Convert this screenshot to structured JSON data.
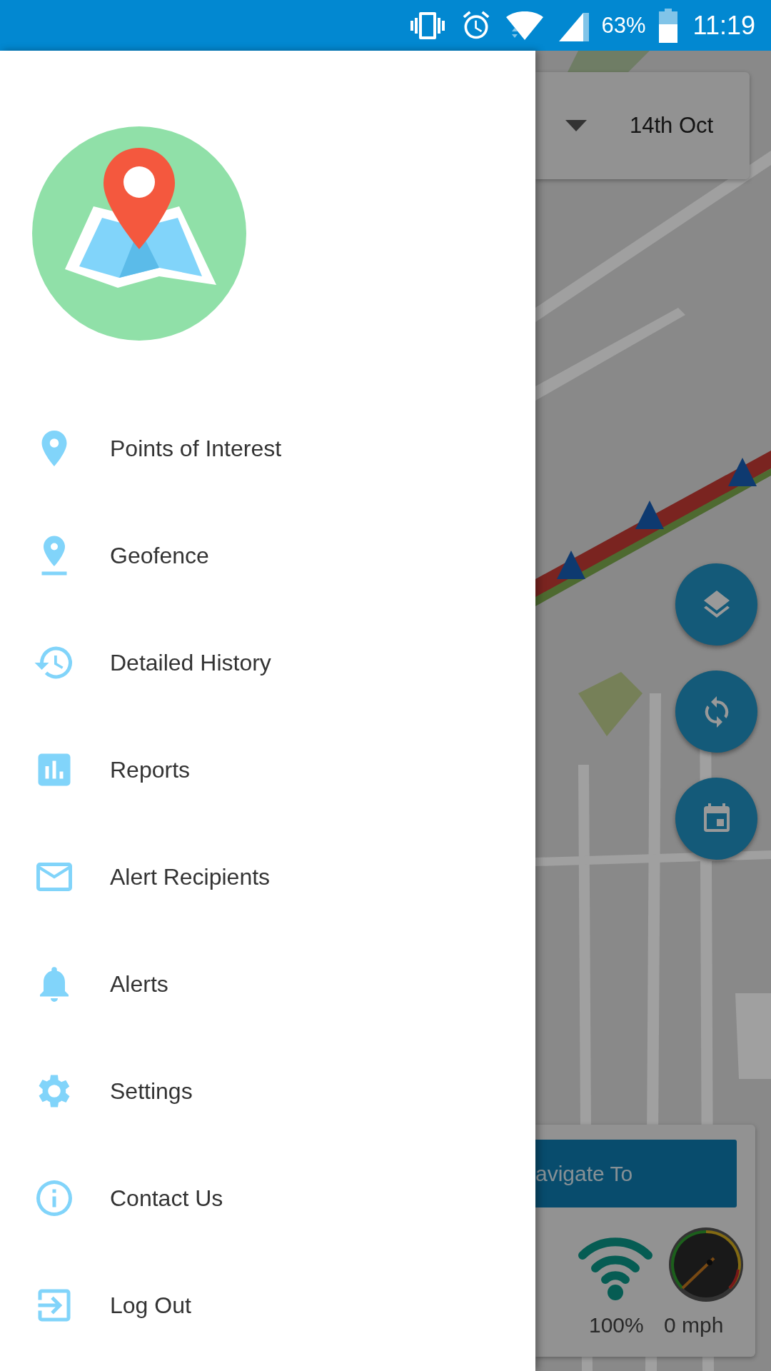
{
  "status_bar": {
    "battery_text": "63%",
    "time": "11:19"
  },
  "drawer": {
    "items": [
      {
        "label": "Points of Interest"
      },
      {
        "label": "Geofence"
      },
      {
        "label": "Detailed History"
      },
      {
        "label": "Reports"
      },
      {
        "label": "Alert Recipients"
      },
      {
        "label": "Alerts"
      },
      {
        "label": "Settings"
      },
      {
        "label": "Contact Us"
      },
      {
        "label": "Log Out"
      }
    ]
  },
  "map": {
    "kind": "picture",
    "date": "14th Oct",
    "navigate_button": "avigate To",
    "signal_text": "100%",
    "speed_text": "0 mph"
  }
}
